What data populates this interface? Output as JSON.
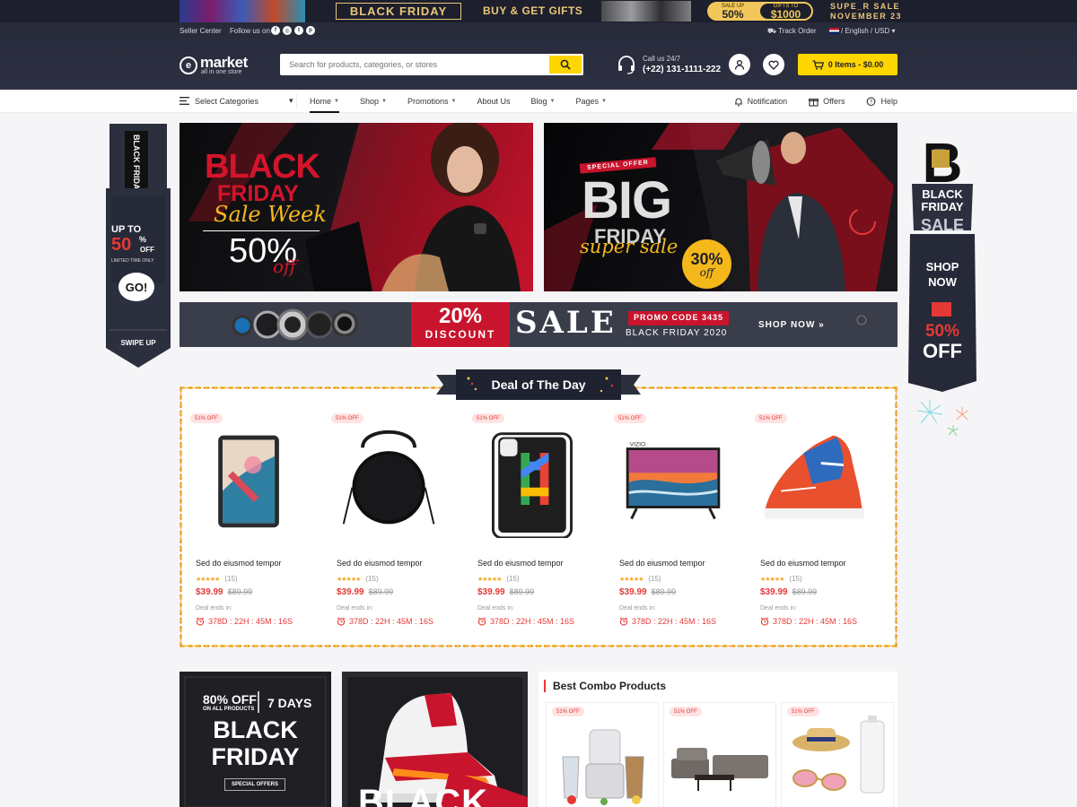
{
  "promo_strip": {
    "black_friday": "BLACK FRIDAY",
    "buy_gifts": "BUY & GET GIFTS",
    "sale_up_label": "SALE UP",
    "sale_up_value": "50%",
    "gifts_to_label": "GIFTS TO",
    "gifts_to_value": "$1000",
    "super_sale": "SUPE_R SALE",
    "super_sale_date": "NOVEMBER 23"
  },
  "topbar": {
    "seller_center": "Seller Center",
    "follow_us": "Follow us on",
    "track_order": "Track Order",
    "language_currency": "/ English / USD"
  },
  "header": {
    "logo_letter": "e",
    "logo_name": "market",
    "logo_tagline": "all in one store",
    "search_placeholder": "Search for products, categories, or stores",
    "call_label": "Call us 24/7",
    "call_number": "(+22) 131-1111-222",
    "cart_label": "0 Items - $0.00"
  },
  "nav": {
    "select_categories": "Select Categories",
    "menu": [
      {
        "label": "Home",
        "active": true,
        "dropdown": true
      },
      {
        "label": "Shop",
        "active": false,
        "dropdown": true
      },
      {
        "label": "Promotions",
        "active": false,
        "dropdown": true
      },
      {
        "label": "About Us",
        "active": false,
        "dropdown": false
      },
      {
        "label": "Blog",
        "active": false,
        "dropdown": true
      },
      {
        "label": "Pages",
        "active": false,
        "dropdown": true
      }
    ],
    "notification": "Notification",
    "offers": "Offers",
    "help": "Help"
  },
  "ribbon_left": {
    "tag": "BLACK FRIDAY",
    "up_to": "UP TO",
    "percent": "50",
    "pct_sign": "%",
    "off": "OFF",
    "limited": "LIMITED TIME ONLY",
    "go": "GO!",
    "swipe": "SWIPE UP"
  },
  "ribbon_right": {
    "letter": "B",
    "black": "BLACK",
    "friday": "FRIDAY",
    "sale": "SALE",
    "shop": "SHOP",
    "now": "NOW",
    "percent": "50%",
    "off": "OFF"
  },
  "banner1": {
    "black": "BLACK",
    "friday": "FRIDAY",
    "sale_week": "Sale Week",
    "discount": "50%",
    "off": "off"
  },
  "banner2": {
    "special_offer": "SPECIAL OFFER",
    "big": "BIG",
    "friday": "FRIDAY",
    "super_sale": "super sale",
    "badge": "30%",
    "badge_off": "off"
  },
  "banner3": {
    "percent": "20%",
    "discount": "DISCOUNT",
    "sale": "SALE",
    "promo_code": "PROMO CODE 3435",
    "black_friday": "BLACK FRIDAY 2020",
    "shop_now": "SHOP NOW »"
  },
  "deal": {
    "title": "Deal of The Day",
    "ends_label": "Deal ends in:",
    "products": [
      {
        "badge": "51% OFF",
        "title": "Sed do eiusmod tempor",
        "reviews": "(15)",
        "price": "$39.99",
        "old_price": "$89.99",
        "timer": "378D : 22H : 45M : 16S",
        "kind": "tablet",
        "rating": 5
      },
      {
        "badge": "51% OFF",
        "title": "Sed do eiusmod tempor",
        "reviews": "(15)",
        "price": "$39.99",
        "old_price": "$89.99",
        "timer": "378D : 22H : 45M : 16S",
        "kind": "bag",
        "rating": 5
      },
      {
        "badge": "51% OFF",
        "title": "Sed do eiusmod tempor",
        "reviews": "(15)",
        "price": "$39.99",
        "old_price": "$89.99",
        "timer": "378D : 22H : 45M : 16S",
        "kind": "phone",
        "rating": 5
      },
      {
        "badge": "51% OFF",
        "title": "Sed do eiusmod tempor",
        "reviews": "(15)",
        "price": "$39.99",
        "old_price": "$89.99",
        "timer": "378D : 22H : 45M : 16S",
        "kind": "tv",
        "rating": 5
      },
      {
        "badge": "51% OFF",
        "title": "Sed do eiusmod tempor",
        "reviews": "(15)",
        "price": "$39.99",
        "old_price": "$89.99",
        "timer": "378D : 22H : 45M : 16S",
        "kind": "shoe",
        "rating": 5
      }
    ]
  },
  "promo_a": {
    "line1": "80% OFF",
    "line1b": "ON ALL PRODUCTS",
    "days": "7 DAYS",
    "black": "BLACK",
    "friday": "FRIDAY",
    "special": "SPECIAL OFFERS"
  },
  "promo_b": {
    "text": "BLACK"
  },
  "combo": {
    "title": "Best Combo Products",
    "items": [
      {
        "badge": "51% OFF",
        "kind": "juicer"
      },
      {
        "badge": "51% OFF",
        "kind": "sofa"
      },
      {
        "badge": "51% OFF",
        "kind": "accessories"
      }
    ]
  },
  "colors": {
    "accent_yellow": "#ffd600",
    "header_dark": "#272a39",
    "sale_red": "#e53935",
    "gold": "#e9c77a"
  }
}
